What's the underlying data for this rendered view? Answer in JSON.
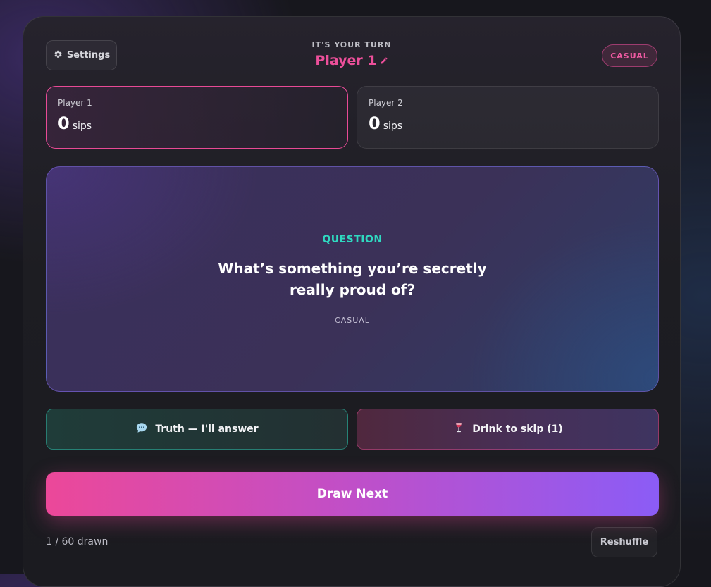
{
  "header": {
    "settings_label": "Settings",
    "turn_label": "IT'S YOUR TURN",
    "current_player": "Player 1",
    "mode_badge": "CASUAL"
  },
  "players": [
    {
      "name": "Player 1",
      "sips": "0",
      "unit": "sips",
      "active": true
    },
    {
      "name": "Player 2",
      "sips": "0",
      "unit": "sips",
      "active": false
    }
  ],
  "card": {
    "type": "QUESTION",
    "text": "What’s something you’re secretly really proud of?",
    "category": "CASUAL"
  },
  "actions": {
    "truth_label": "Truth — I'll answer",
    "truth_icon": "speech-bubble-icon",
    "drink_label": "Drink to skip (1)",
    "drink_icon": "wine-glass-icon"
  },
  "footer": {
    "draw_label": "Draw Next",
    "drawn_count": "1 / 60 drawn",
    "reshuffle_label": "Reshuffle"
  },
  "colors": {
    "accent_pink": "#ec4899",
    "accent_purple": "#8b5cf6",
    "question_teal": "#2fd9c0",
    "panel_bg": "#1d1d22"
  }
}
